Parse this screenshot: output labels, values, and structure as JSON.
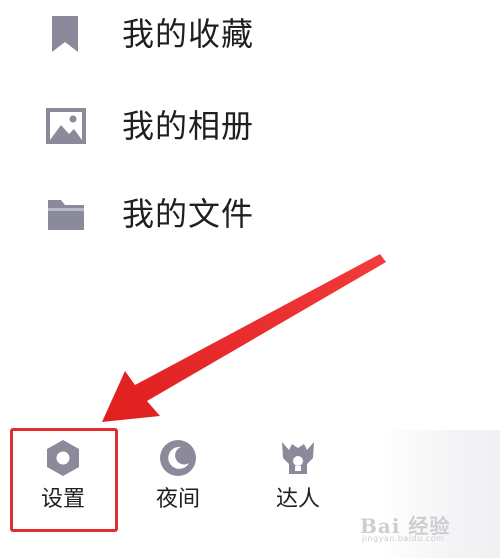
{
  "menu": {
    "items": [
      {
        "label": "我的收藏",
        "icon": "bookmark-icon"
      },
      {
        "label": "我的相册",
        "icon": "image-icon"
      },
      {
        "label": "我的文件",
        "icon": "folder-icon"
      }
    ]
  },
  "toolbar": {
    "items": [
      {
        "label": "设置",
        "icon": "settings-icon"
      },
      {
        "label": "夜间",
        "icon": "moon-icon"
      },
      {
        "label": "达人",
        "icon": "talent-badge-icon"
      }
    ]
  },
  "watermark": {
    "main": "Bai 经验",
    "sub": "jingyan.baidu.com"
  },
  "colors": {
    "icon": "#8a8a9a",
    "text": "#1f1f1f",
    "annotation": "#e12d2d"
  }
}
